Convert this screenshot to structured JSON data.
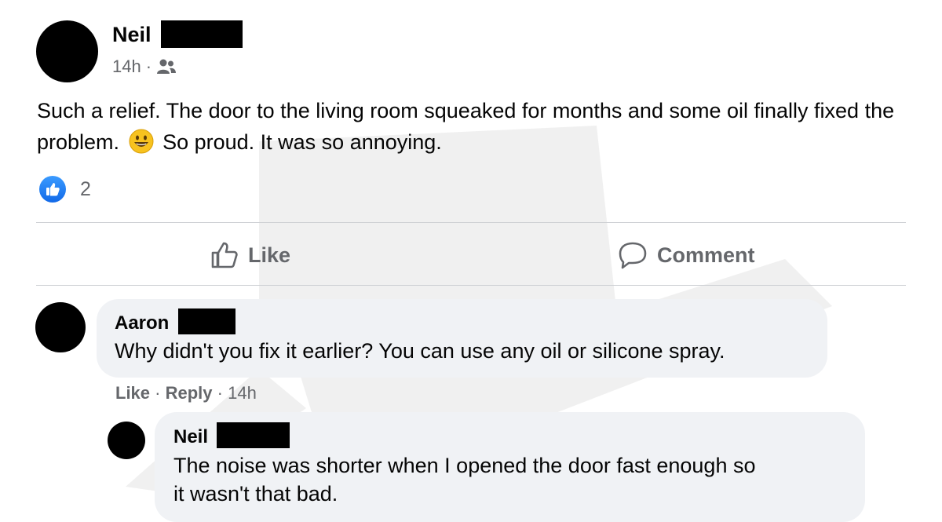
{
  "post": {
    "author": "Neil",
    "time": "14h",
    "separator": "·",
    "audience_icon": "friends-icon",
    "text_before_emoji": "Such a relief. The door to the living room squeaked for months and some oil finally fixed the problem.",
    "emoji": "smiling-face-emoji",
    "text_after_emoji": "So proud. It was so annoying.",
    "reaction_icon": "like-reaction-icon",
    "reaction_count": "2"
  },
  "actions": {
    "like_label": "Like",
    "comment_label": "Comment"
  },
  "comments": [
    {
      "author": "Aaron",
      "text": "Why didn't you fix it earlier? You can use any oil or silicone spray.",
      "like_label": "Like",
      "reply_label": "Reply",
      "time": "14h",
      "separator": "·"
    }
  ],
  "reply": {
    "author": "Neil",
    "text_line1": "The noise was shorter when I opened the door fast enough so",
    "text_line2": "it wasn't that bad."
  },
  "colors": {
    "secondary_text": "#65676b",
    "bubble": "#f0f2f5",
    "like_blue": "#1877f2",
    "divider": "#ced0d4"
  }
}
